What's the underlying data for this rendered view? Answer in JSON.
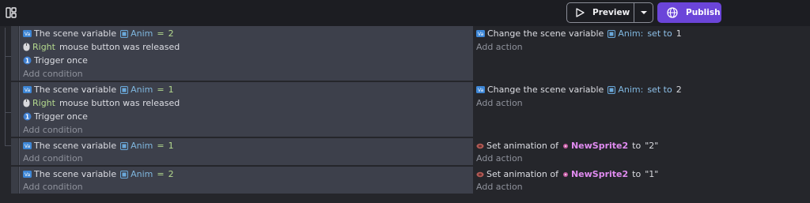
{
  "toolbar": {
    "panel_icon": "panel-layout-icon",
    "preview_label": "Preview",
    "publish_label": "Publish",
    "colors": {
      "publish_bg": "#6b45d9",
      "toolbar_bg": "#1c1d22"
    }
  },
  "common": {
    "add_condition": "Add condition",
    "add_action": "Add action",
    "scene_variable_cond": "The scene variable",
    "change_scene_variable": "Change the scene variable",
    "set_animation_of": "Set animation of",
    "equals": "=",
    "to": "to",
    "set_to": "set to",
    "right": "Right",
    "mouse_released": "mouse button was released",
    "trigger_once": "Trigger once"
  },
  "events": [
    {
      "conditions": [
        {
          "type": "scene-variable",
          "variable": "Anim",
          "value": "2"
        },
        {
          "type": "mouse-released",
          "button": "Right"
        },
        {
          "type": "trigger-once"
        }
      ],
      "actions": [
        {
          "type": "change-variable",
          "variable": "Anim",
          "value": "1"
        }
      ]
    },
    {
      "conditions": [
        {
          "type": "scene-variable",
          "variable": "Anim",
          "value": "1"
        },
        {
          "type": "mouse-released",
          "button": "Right"
        },
        {
          "type": "trigger-once"
        }
      ],
      "actions": [
        {
          "type": "change-variable",
          "variable": "Anim",
          "value": "2"
        }
      ]
    },
    {
      "conditions": [
        {
          "type": "scene-variable",
          "variable": "Anim",
          "value": "1"
        }
      ],
      "actions": [
        {
          "type": "set-animation",
          "object": "NewSprite2",
          "value": "\"2\""
        }
      ]
    },
    {
      "conditions": [
        {
          "type": "scene-variable",
          "variable": "Anim",
          "value": "2"
        }
      ],
      "actions": [
        {
          "type": "set-animation",
          "object": "NewSprite2",
          "value": "\"1\""
        }
      ]
    }
  ]
}
